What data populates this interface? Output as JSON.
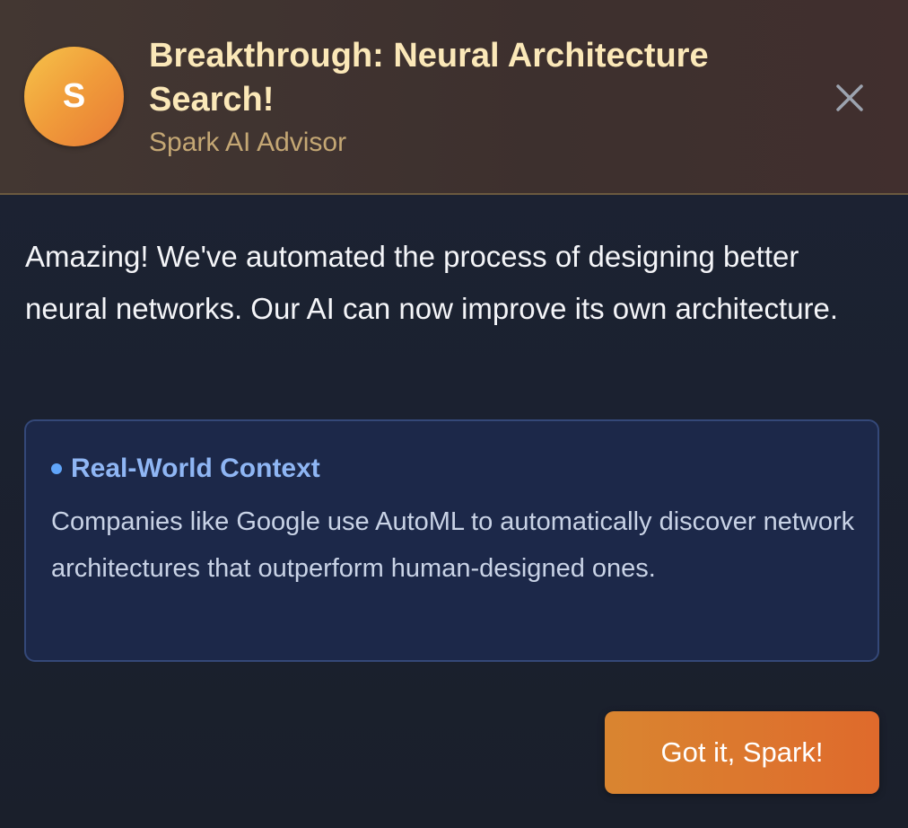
{
  "header": {
    "avatar_letter": "S",
    "title": "Breakthrough: Neural Architecture Search!",
    "subtitle": "Spark AI Advisor",
    "close_icon": "close-icon"
  },
  "body": {
    "message": "Amazing! We've automated the process of designing better neural networks. Our AI can now improve its own architecture."
  },
  "context": {
    "title": "Real-World Context",
    "text": "Companies like Google use AutoML to automatically discover network architectures that outperform human-designed ones."
  },
  "actions": {
    "confirm_label": "Got it, Spark!"
  },
  "colors": {
    "accent": "#e8813a",
    "title": "#fbe8b8",
    "context_accent": "#60a5fa"
  }
}
